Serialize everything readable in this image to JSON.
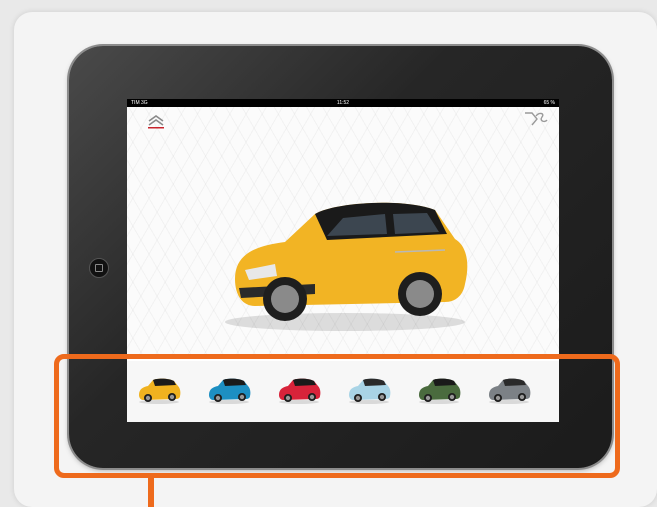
{
  "status_bar": {
    "carrier": "TIM 3G",
    "time": "11:52",
    "battery": "65 %"
  },
  "colors": {
    "annotation": "#ee6a1c",
    "ipad_frame": "#1b1b1b",
    "hero_car_body": "#f2b424",
    "hero_car_roof": "#1a1a1a"
  },
  "gallery": {
    "thumbnails": [
      {
        "icon": "car-yellow-icon",
        "color": "#f0b21f",
        "roof": "#1a1a1a"
      },
      {
        "icon": "car-cyan-icon",
        "color": "#1d8fc2",
        "roof": "#1a1a1a"
      },
      {
        "icon": "car-red-icon",
        "color": "#d8233a",
        "roof": "#1a1a1a"
      },
      {
        "icon": "car-light-blue-icon",
        "color": "#a9d4e6",
        "roof": "#2a2a2a"
      },
      {
        "icon": "car-green-icon",
        "color": "#4a6b3e",
        "roof": "#1a1a1a"
      },
      {
        "icon": "car-grey-icon",
        "color": "#7c8186",
        "roof": "#2a2a2a"
      }
    ]
  }
}
